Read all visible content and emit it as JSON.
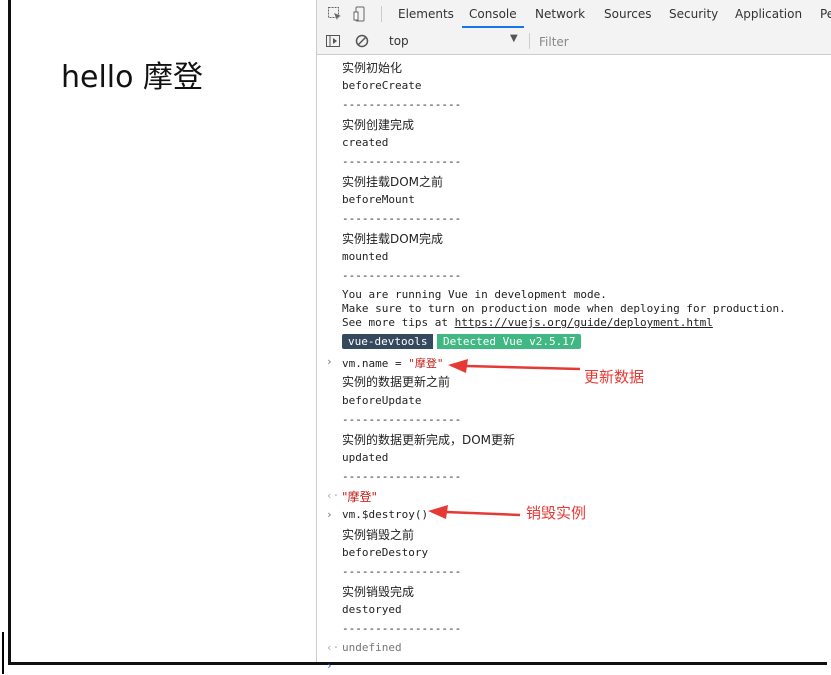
{
  "page": {
    "heading": "hello 摩登"
  },
  "devtools": {
    "tabs": [
      {
        "label": "Elements"
      },
      {
        "label": "Console"
      },
      {
        "label": "Network"
      },
      {
        "label": "Sources"
      },
      {
        "label": "Security"
      },
      {
        "label": "Application"
      },
      {
        "label": "Pe"
      }
    ],
    "active_tab": "Console",
    "context": "top",
    "filter_placeholder": "Filter"
  },
  "console": {
    "l1": "实例初始化",
    "l2": "beforeCreate",
    "l3": "------------------",
    "l4": "实例创建完成",
    "l5": "created",
    "l6": "------------------",
    "l7": "实例挂载DOM之前",
    "l8": "beforeMount",
    "l9": "------------------",
    "l10": "实例挂载DOM完成",
    "l11": "mounted",
    "l12": "------------------",
    "dev1": "You are running Vue in development mode.",
    "dev2": "Make sure to turn on production mode when deploying for production.",
    "dev3_prefix": "See more tips at ",
    "dev3_link": "https://vuejs.org/guide/deployment.html",
    "badge_left": "vue-devtools",
    "badge_right": "Detected Vue v2.5.17",
    "cmd1_code": "vm.name = ",
    "cmd1_str": "\"摩登\"",
    "l13": "实例的数据更新之前",
    "l14": "beforeUpdate",
    "l15": "------------------",
    "l16": "实例的数据更新完成，DOM更新",
    "l17": "updated",
    "l18": "------------------",
    "ret1": "\"摩登\"",
    "cmd2_code": "vm.$destroy()",
    "l19": "实例销毁之前",
    "l20": "beforeDestory",
    "l21": "------------------",
    "l22": "实例销毁完成",
    "l23": "destoryed",
    "l24": "------------------",
    "ret2": "undefined"
  },
  "annotations": {
    "update_label": "更新数据",
    "destroy_label": "销毁实例",
    "color": "#e53935"
  }
}
